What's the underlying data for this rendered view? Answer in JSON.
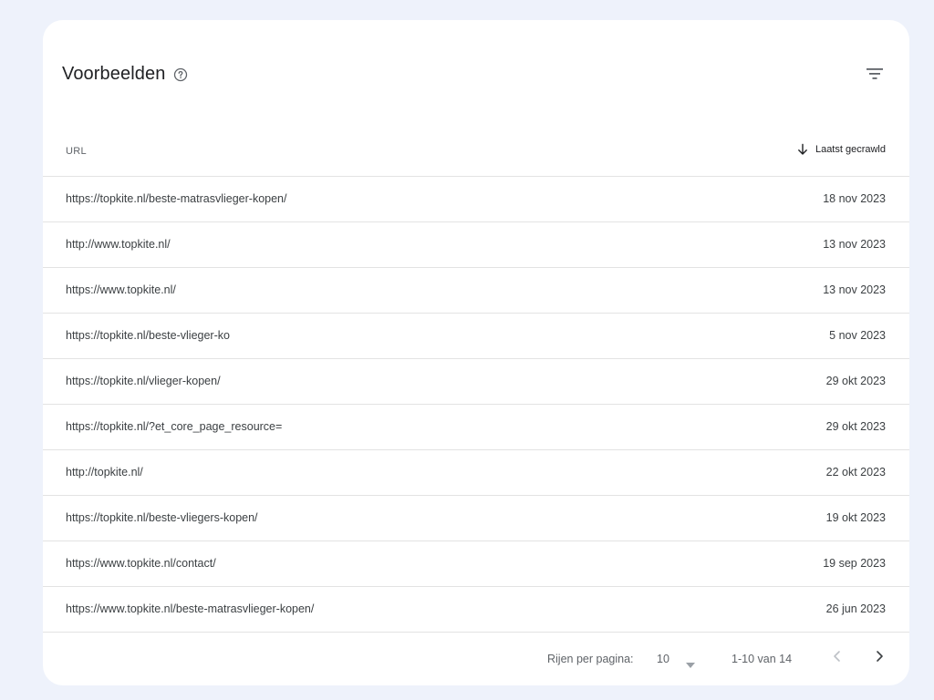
{
  "header": {
    "title": "Voorbeelden",
    "help_icon": "help-circle-icon",
    "filter_icon": "filter-icon"
  },
  "table": {
    "columns": {
      "url": "URL",
      "date": "Laatst gecrawld"
    },
    "sort_icon": "arrow-down-icon",
    "rows": [
      {
        "url": "https://topkite.nl/beste-matrasvlieger-kopen/",
        "date": "18 nov 2023"
      },
      {
        "url": "http://www.topkite.nl/",
        "date": "13 nov 2023"
      },
      {
        "url": "https://www.topkite.nl/",
        "date": "13 nov 2023"
      },
      {
        "url": "https://topkite.nl/beste-vlieger-ko",
        "date": "5 nov 2023"
      },
      {
        "url": "https://topkite.nl/vlieger-kopen/",
        "date": "29 okt 2023"
      },
      {
        "url": "https://topkite.nl/?et_core_page_resource=",
        "date": "29 okt 2023"
      },
      {
        "url": "http://topkite.nl/",
        "date": "22 okt 2023"
      },
      {
        "url": "https://topkite.nl/beste-vliegers-kopen/",
        "date": "19 okt 2023"
      },
      {
        "url": "https://www.topkite.nl/contact/",
        "date": "19 sep 2023"
      },
      {
        "url": "https://www.topkite.nl/beste-matrasvlieger-kopen/",
        "date": "26 jun 2023"
      }
    ]
  },
  "pagination": {
    "rows_label": "Rijen per pagina:",
    "rows_value": "10",
    "range": "1-10 van 14",
    "prev_icon": "chevron-left-icon",
    "next_icon": "chevron-right-icon"
  },
  "colors": {
    "background": "#eef2fb",
    "card": "#ffffff",
    "text": "#3c4043",
    "divider": "#e3e3e3"
  }
}
